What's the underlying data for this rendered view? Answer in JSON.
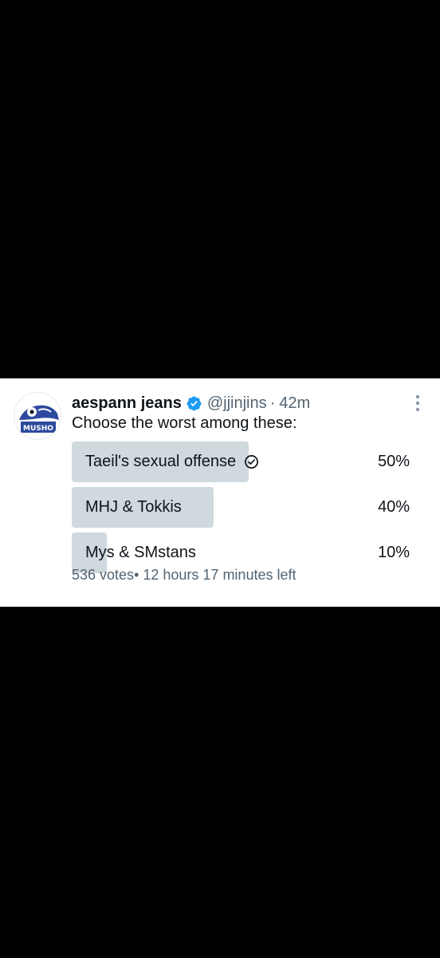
{
  "tweet": {
    "display_name": "aespann jeans",
    "handle": "@jjinjins",
    "separator": "·",
    "time": "42m",
    "text": "Choose the worst among these:",
    "poll": {
      "options": [
        {
          "label": "Taeil's sexual offense",
          "percent_text": "50%",
          "share": 0.5,
          "selected": true
        },
        {
          "label": "MHJ & Tokkis",
          "percent_text": "40%",
          "share": 0.4,
          "selected": false
        },
        {
          "label": "Mys & SMstans",
          "percent_text": "10%",
          "share": 0.1,
          "selected": false
        }
      ],
      "votes": "536 votes",
      "time_left": "• 12 hours 17 minutes left"
    },
    "avatar_text": "MUSHO"
  },
  "colors": {
    "background": "#000000",
    "card": "#ffffff",
    "verified": "#1d9bf0",
    "poll_fill": "#cfd9de",
    "muted_text": "#536471",
    "avatar_blue": "#2e4a9e"
  },
  "icons": {
    "verified": "verified-badge-icon",
    "check": "check-circle-icon",
    "more": "more-vertical-icon"
  }
}
